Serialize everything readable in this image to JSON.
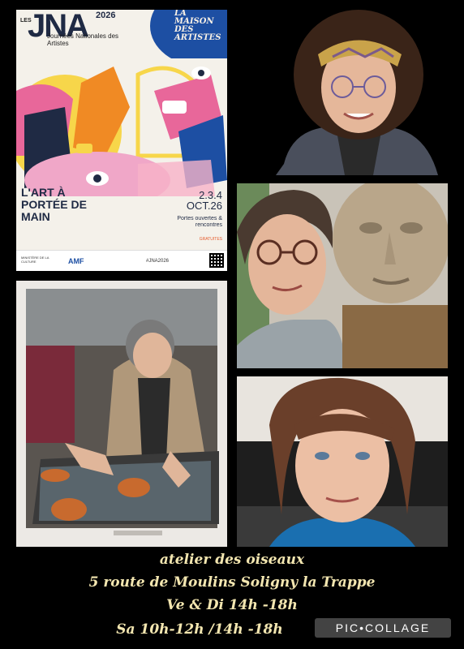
{
  "poster": {
    "les": "LES",
    "logo": "JNA",
    "year": "2026",
    "subtitle": "Journées Nationales des Artistes",
    "maison": "LA MAISON DES ARTISTES",
    "title": "L'ART À PORTÉE DE MAIN",
    "dates": "2.3.4 OCT.26",
    "open": "Portes ouvertes & rencontres",
    "free": "GRATUITES",
    "ministry": "MINISTÈRE DE LA CULTURE",
    "amf": "AMF",
    "hashtag": "#JNA2026"
  },
  "caption": {
    "line1": "atelier des oiseaux",
    "line2": "5 route de Moulins Soligny la Trappe",
    "line3": "Ve & Di  14h -18h",
    "line4": "Sa 10h-12h /14h -18h"
  },
  "watermark": "PIC•COLLAGE",
  "colors": {
    "background": "#000000",
    "caption_text": "#f3e6b0",
    "poster_navy": "#1f2a44",
    "poster_blue": "#1d4fa3",
    "poster_orange": "#f08a24",
    "poster_pink": "#e8679a"
  }
}
